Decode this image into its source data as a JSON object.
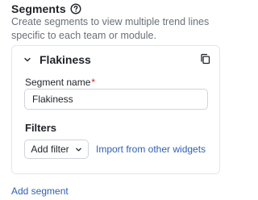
{
  "section": {
    "title": "Segments",
    "help_icon": "question-circle-icon",
    "description": "Create segments to view multiple trend lines specific to each team or module."
  },
  "segment": {
    "title": "Flakiness",
    "collapse_icon": "chevron-down-icon",
    "copy_icon": "copy-icon",
    "name_label": "Segment name",
    "required_mark": "*",
    "name_value": "Flakiness",
    "filters_label": "Filters",
    "add_filter_label": "Add filter",
    "import_link": "Import from other widgets"
  },
  "add_segment_label": "Add segment",
  "colors": {
    "text": "#1f2328",
    "muted": "#6b7078",
    "link": "#2f5fb3",
    "required": "#d1242f",
    "border": "#d0d4da"
  }
}
